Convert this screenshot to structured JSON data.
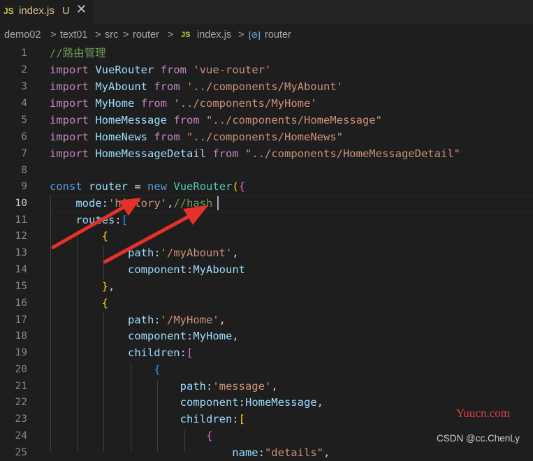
{
  "tab": {
    "badge": "JS",
    "filename": "index.js",
    "status": "U",
    "close": "✕"
  },
  "breadcrumb": {
    "items": [
      "demo02",
      "text01",
      "src",
      "router"
    ],
    "sep": ">",
    "file_badge": "JS",
    "file": "index.js",
    "symbol_icon": "[⊘]",
    "symbol": "router"
  },
  "editor": {
    "line_numbers": [
      "1",
      "2",
      "3",
      "4",
      "5",
      "6",
      "7",
      "8",
      "9",
      "10",
      "11",
      "12",
      "13",
      "14",
      "15",
      "16",
      "17",
      "18",
      "19",
      "20",
      "21",
      "22",
      "23",
      "24",
      "25"
    ],
    "active_line": "10",
    "lines": [
      "//路由管理",
      "import VueRouter from 'vue-router'",
      "import MyAbount from '../components/MyAbount'",
      "import MyHome from '../components/MyHome'",
      "import HomeMessage from \"../components/HomeMessage\"",
      "import HomeNews from \"../components/HomeNews\"",
      "import HomeMessageDetail from \"../components/HomeMessageDetail\"",
      "",
      "const router = new VueRouter({",
      "    mode:'history',//hash",
      "    routes:[",
      "        {",
      "            path:'/myAbount',",
      "            component:MyAbount",
      "        },",
      "        {",
      "            path:'/MyHome',",
      "            component:MyHome,",
      "            children:[",
      "                {",
      "                    path:'message',",
      "                    component:HomeMessage,",
      "                    children:[",
      "                        {",
      "                            name:\"details\","
    ]
  },
  "annotations": {
    "arrows": [
      "red-arrow-to-history",
      "red-arrow-to-hash"
    ],
    "arrow_color": "#e8302a"
  },
  "watermarks": {
    "yuucn": "Yuucn.com",
    "csdn": "CSDN @cc.ChenLy"
  }
}
